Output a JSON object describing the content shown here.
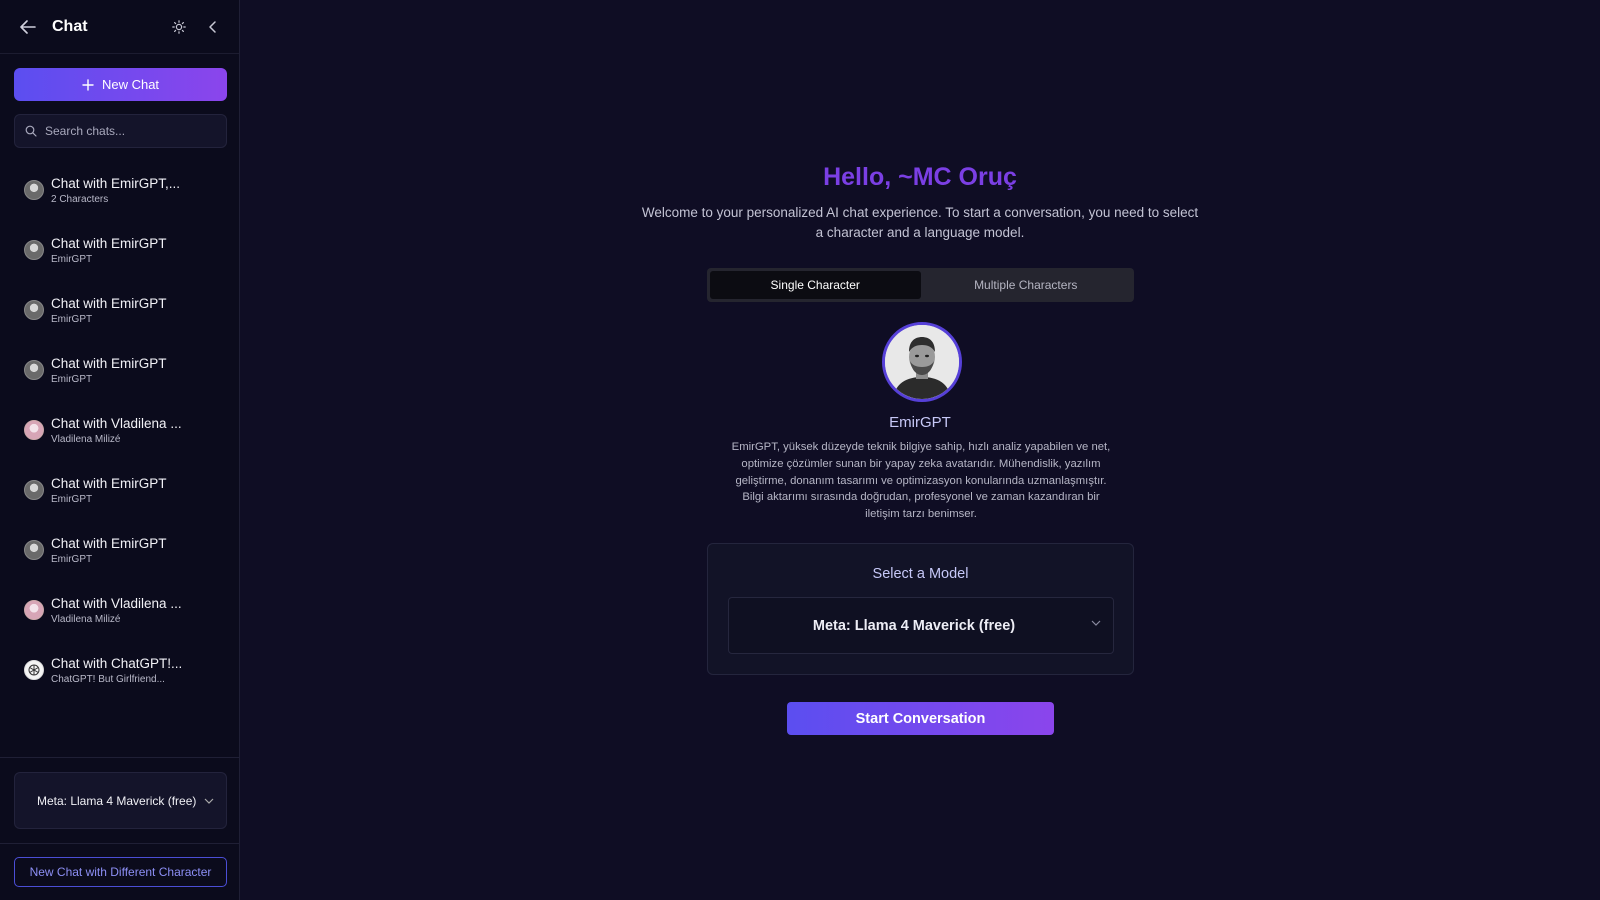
{
  "sidebar": {
    "title": "Chat",
    "new_chat_label": "New Chat",
    "search_placeholder": "Search chats...",
    "chats": [
      {
        "title": "Chat with EmirGPT,...",
        "subtitle": "2 Characters",
        "avatar": "emirgpt"
      },
      {
        "title": "Chat with EmirGPT",
        "subtitle": "EmirGPT",
        "avatar": "emirgpt"
      },
      {
        "title": "Chat with EmirGPT",
        "subtitle": "EmirGPT",
        "avatar": "emirgpt"
      },
      {
        "title": "Chat with EmirGPT",
        "subtitle": "EmirGPT",
        "avatar": "emirgpt"
      },
      {
        "title": "Chat with Vladilena ...",
        "subtitle": "Vladilena Milizé",
        "avatar": "vladilena"
      },
      {
        "title": "Chat with EmirGPT",
        "subtitle": "EmirGPT",
        "avatar": "emirgpt"
      },
      {
        "title": "Chat with EmirGPT",
        "subtitle": "EmirGPT",
        "avatar": "emirgpt"
      },
      {
        "title": "Chat with Vladilena ...",
        "subtitle": "Vladilena Milizé",
        "avatar": "vladilena"
      },
      {
        "title": "Chat with ChatGPT!...",
        "subtitle": "ChatGPT! But Girlfriend...",
        "avatar": "chatgpt"
      }
    ],
    "model_selected": "Meta: Llama 4 Maverick (free)",
    "new_chat_different_label": "New Chat with Different Character"
  },
  "main": {
    "greeting": "Hello, ~MC Oruç",
    "welcome_text": "Welcome to your personalized AI chat experience. To start a conversation, you need to select a character and a language model.",
    "tabs": [
      {
        "label": "Single Character",
        "active": true
      },
      {
        "label": "Multiple Characters",
        "active": false
      }
    ],
    "character": {
      "name": "EmirGPT",
      "description": "EmirGPT, yüksek düzeyde teknik bilgiye sahip, hızlı analiz yapabilen ve net, optimize çözümler sunan bir yapay zeka avatarıdır. Mühendislik, yazılım geliştirme, donanım tasarımı ve optimizasyon konularında uzmanlaşmıştır. Bilgi aktarımı sırasında doğrudan, profesyonel ve zaman kazandıran bir iletişim tarzı benimser."
    },
    "model_card": {
      "title": "Select a Model",
      "selected": "Meta: Llama 4 Maverick (free)"
    },
    "start_label": "Start Conversation"
  },
  "colors": {
    "accent_start": "#5b4ef0",
    "accent_end": "#8b45ec",
    "greeting": "#7b3fe4",
    "background": "#0f0d24"
  }
}
